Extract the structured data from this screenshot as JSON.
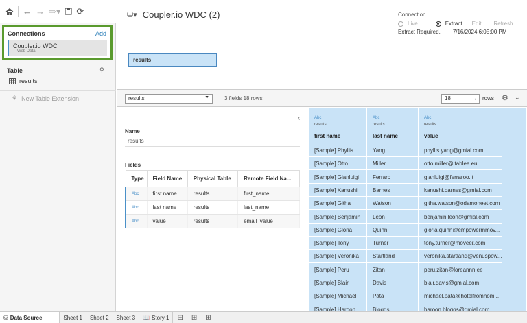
{
  "toolbar": {
    "icons": [
      "home-icon",
      "back-icon",
      "forward-icon",
      "redo-icon",
      "save-icon",
      "refresh-icon"
    ]
  },
  "connections": {
    "title": "Connections",
    "add_label": "Add",
    "item": {
      "name": "Coupler.io WDC",
      "subtitle": "Web Data"
    }
  },
  "table_section": {
    "title": "Table",
    "tables": [
      {
        "name": "results"
      }
    ],
    "new_extension_label": "New Table Extension"
  },
  "datasource": {
    "title": "Coupler.io WDC (2)",
    "canvas_table": "results"
  },
  "connection_mode": {
    "label": "Connection",
    "live": "Live",
    "extract": "Extract",
    "edit": "Edit",
    "refresh": "Refresh",
    "status": "Extract Required.",
    "timestamp": "7/16/2024 6:05:00 PM",
    "selected": "extract"
  },
  "midbar": {
    "table_select": "results",
    "field_count": "3 fields 18 rows",
    "rows_value": "18",
    "rows_label": "rows"
  },
  "metadata": {
    "name_label": "Name",
    "name_value": "results",
    "fields_label": "Fields",
    "columns": [
      "Type",
      "Field Name",
      "Physical Table",
      "Remote Field Na..."
    ],
    "rows": [
      {
        "type": "Abc",
        "field": "first name",
        "table": "results",
        "remote": "first_name"
      },
      {
        "type": "Abc",
        "field": "last name",
        "table": "results",
        "remote": "last_name"
      },
      {
        "type": "Abc",
        "field": "value",
        "table": "results",
        "remote": "email_value"
      }
    ]
  },
  "grid": {
    "columns": [
      {
        "type": "Abc",
        "source": "results",
        "name": "first name"
      },
      {
        "type": "Abc",
        "source": "results",
        "name": "last name"
      },
      {
        "type": "Abc",
        "source": "results",
        "name": "value"
      }
    ],
    "rows": [
      [
        "[Sample] Phyllis",
        "Yang",
        "phyllis.yang@gmial.com"
      ],
      [
        "[Sample] Otto",
        "Miller",
        "otto.miller@itablee.eu"
      ],
      [
        "[Sample] Gianluigi",
        "Ferraro",
        "gianluigi@ferraroo.it"
      ],
      [
        "[Sample] Kanushi",
        "Barnes",
        "kanushi.barnes@gmial.com"
      ],
      [
        "[Sample] Githa",
        "Watson",
        "githa.watson@odamoneet.com"
      ],
      [
        "[Sample] Benjamin",
        "Leon",
        "benjamin.leon@gmial.com"
      ],
      [
        "[Sample] Gloria",
        "Quinn",
        "gloria.quinn@empowermmov..."
      ],
      [
        "[Sample] Tony",
        "Turner",
        "tony.turner@moveer.com"
      ],
      [
        "[Sample] Veronika",
        "Startland",
        "veronika.startland@venuspow..."
      ],
      [
        "[Sample] Peru",
        "Zitan",
        "peru.zitan@loreannn.ee"
      ],
      [
        "[Sample] Blair",
        "Davis",
        "blair.davis@gmial.com"
      ],
      [
        "[Sample] Michael",
        "Pata",
        "michael.pata@hotelfromhom..."
      ],
      [
        "[Sample] Haroon",
        "Bloggs",
        "haroon.bloggs@gmial.com"
      ]
    ]
  },
  "tabs": {
    "data_source": "Data Source",
    "sheets": [
      "Sheet 1",
      "Sheet 2",
      "Sheet 3"
    ],
    "story": "Story 1"
  }
}
